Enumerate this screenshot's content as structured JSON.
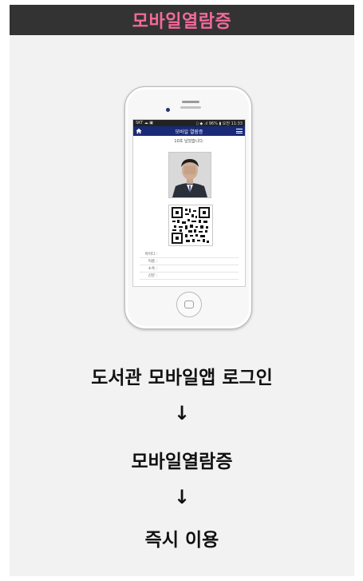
{
  "header": {
    "title": "모바일열람증"
  },
  "phone": {
    "status_left": "SKT ☁ ▣",
    "status_right": "▯ ◆ .ıl 96% ▮ 오전 11:33",
    "app_title": "모바일 열람증",
    "timer_text": "10초 남았습니다.",
    "fields": [
      {
        "label": "아이디 :"
      },
      {
        "label": "이름 :"
      },
      {
        "label": "소속 :"
      },
      {
        "label": "신분 :"
      }
    ]
  },
  "steps": {
    "step1": "도서관 모바일앱 로그인",
    "arrow1": "↓",
    "step2": "모바일열람증",
    "arrow2": "↓",
    "step3": "즉시 이용"
  },
  "colors": {
    "header_bg": "#333333",
    "header_text": "#f36a9a",
    "app_bar": "#1a2a78",
    "card_bg": "#f2f2f2"
  }
}
